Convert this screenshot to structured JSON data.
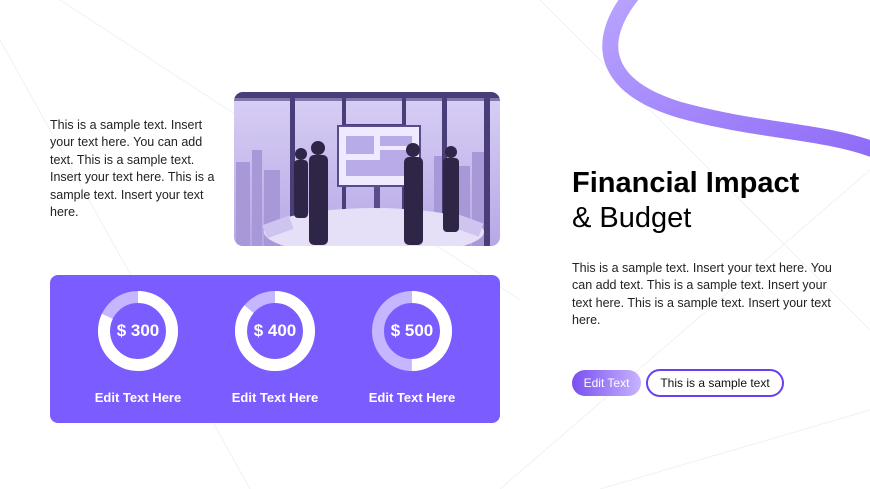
{
  "left_text": "This is a sample text. Insert your text here. You can add text. This is a sample text. Insert your text here. This is a sample text. Insert your text here.",
  "metrics": [
    {
      "value": "$ 300",
      "label": "Edit Text Here",
      "fill": 0.82
    },
    {
      "value": "$ 400",
      "label": "Edit Text Here",
      "fill": 0.86
    },
    {
      "value": "$ 500",
      "label": "Edit Text Here",
      "fill": 0.5
    }
  ],
  "title": {
    "line1": "Financial Impact",
    "line2": "& Budget"
  },
  "right_text": "This is a sample text. Insert your text here. You can add text. This is a sample text. Insert your text here. This is a sample text. Insert your text here.",
  "buttons": {
    "primary": "Edit Text",
    "secondary": "This is a sample text"
  },
  "colors": {
    "accent": "#7b5cff",
    "accent_light": "#c9b8ff",
    "ring_track": "#c6b6ff",
    "text": "#222222"
  }
}
